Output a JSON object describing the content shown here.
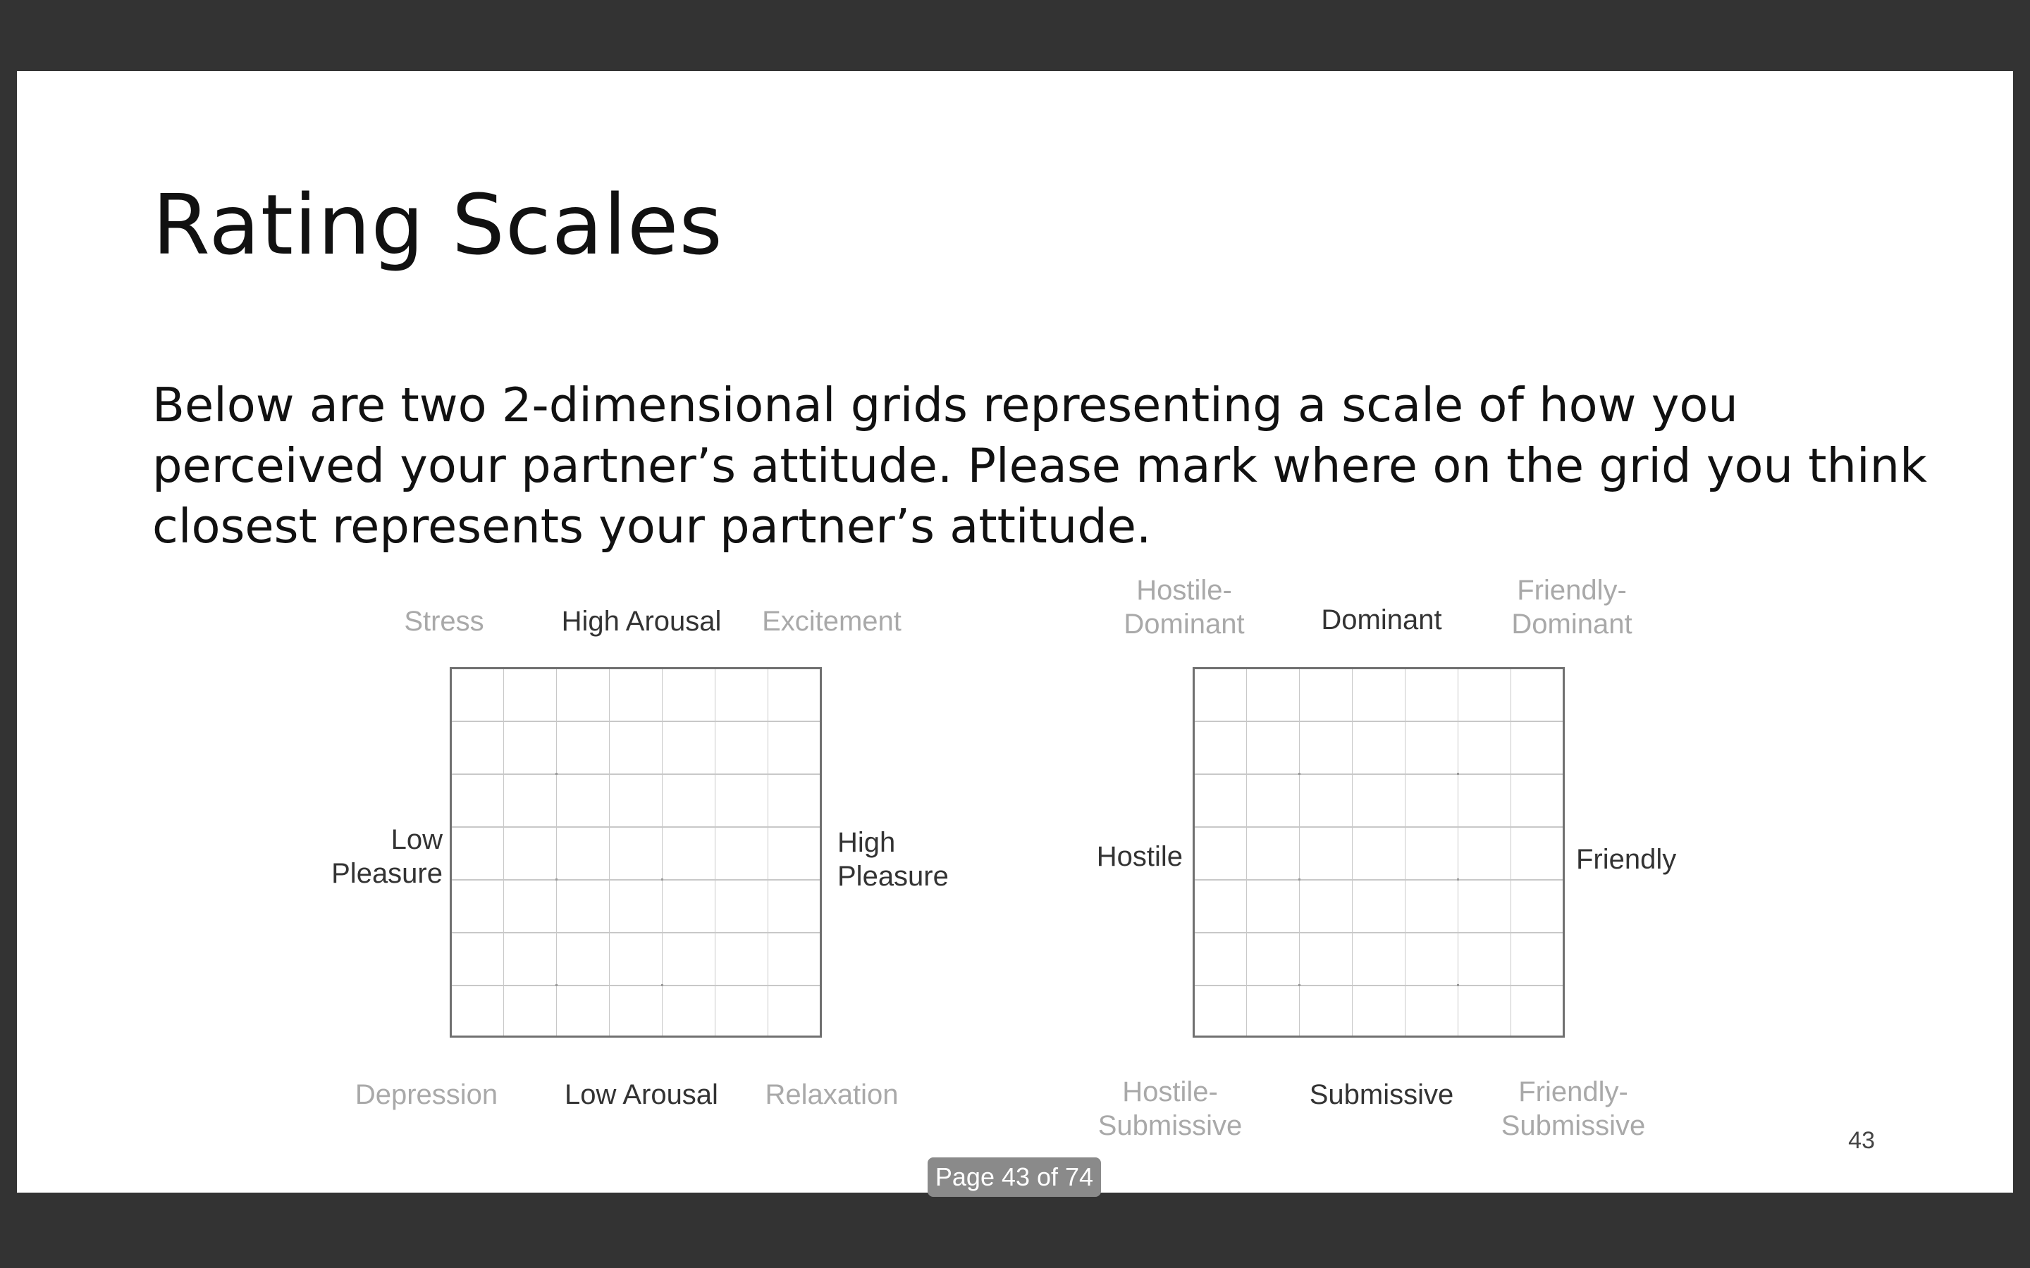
{
  "slide": {
    "title": "Rating Scales",
    "body": "Below are two 2-dimensional grids representing a scale of how you perceived your partner’s attitude. Please mark where on the grid you think closest represents your partner’s attitude.",
    "slide_number": "43"
  },
  "grid_left": {
    "top_left": "Stress",
    "top": "High Arousal",
    "top_right": "Excitement",
    "left_line1": "Low",
    "left_line2": "Pleasure",
    "right_line1": "High",
    "right_line2": "Pleasure",
    "bottom_left": "Depression",
    "bottom": "Low Arousal",
    "bottom_right": "Relaxation"
  },
  "grid_right": {
    "top_left_line1": "Hostile-",
    "top_left_line2": "Dominant",
    "top": "Dominant",
    "top_right_line1": "Friendly-",
    "top_right_line2": "Dominant",
    "left": "Hostile",
    "right": "Friendly",
    "bottom_left_line1": "Hostile-",
    "bottom_left_line2": "Submissive",
    "bottom": "Submissive",
    "bottom_right_line1": "Friendly-",
    "bottom_right_line2": "Submissive"
  },
  "viewer": {
    "page_indicator": "Page 43 of 74"
  }
}
